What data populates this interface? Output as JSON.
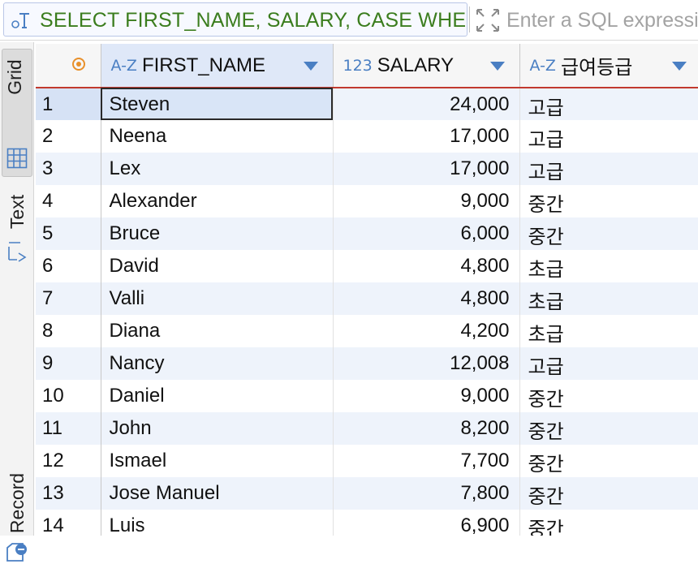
{
  "filter": {
    "query": "SELECT FIRST_NAME, SALARY, CASE WHE",
    "placeholder": "Enter a SQL expression to filter results"
  },
  "side_tabs": {
    "grid": "Grid",
    "text": "Text",
    "record": "Record"
  },
  "columns": [
    {
      "type": "A-Z",
      "label": "FIRST_NAME"
    },
    {
      "type": "123",
      "label": "SALARY"
    },
    {
      "type": "A-Z",
      "label": "급여등급"
    }
  ],
  "rows": [
    {
      "n": "1",
      "name": "Steven",
      "salary": "24,000",
      "grade": "고급"
    },
    {
      "n": "2",
      "name": "Neena",
      "salary": "17,000",
      "grade": "고급"
    },
    {
      "n": "3",
      "name": "Lex",
      "salary": "17,000",
      "grade": "고급"
    },
    {
      "n": "4",
      "name": "Alexander",
      "salary": "9,000",
      "grade": "중간"
    },
    {
      "n": "5",
      "name": "Bruce",
      "salary": "6,000",
      "grade": "중간"
    },
    {
      "n": "6",
      "name": "David",
      "salary": "4,800",
      "grade": "초급"
    },
    {
      "n": "7",
      "name": "Valli",
      "salary": "4,800",
      "grade": "초급"
    },
    {
      "n": "8",
      "name": "Diana",
      "salary": "4,200",
      "grade": "초급"
    },
    {
      "n": "9",
      "name": "Nancy",
      "salary": "12,008",
      "grade": "고급"
    },
    {
      "n": "10",
      "name": "Daniel",
      "salary": "9,000",
      "grade": "중간"
    },
    {
      "n": "11",
      "name": "John",
      "salary": "8,200",
      "grade": "중간"
    },
    {
      "n": "12",
      "name": "Ismael",
      "salary": "7,700",
      "grade": "중간"
    },
    {
      "n": "13",
      "name": "Jose Manuel",
      "salary": "7,800",
      "grade": "중간"
    },
    {
      "n": "14",
      "name": "Luis",
      "salary": "6,900",
      "grade": "중간"
    }
  ],
  "colors": {
    "query_text": "#3b7d1e",
    "type_icon": "#4a7fc3",
    "header_accent": "#c23a2d",
    "row_alt": "#eef3fb",
    "status_dot": "#e8902a"
  },
  "icons": {
    "query": "sql-filter-icon",
    "expand": "expand-arrows-icon",
    "grid": "grid-icon",
    "text": "text-view-icon",
    "record": "record-view-icon",
    "status": "status-dot-icon"
  }
}
